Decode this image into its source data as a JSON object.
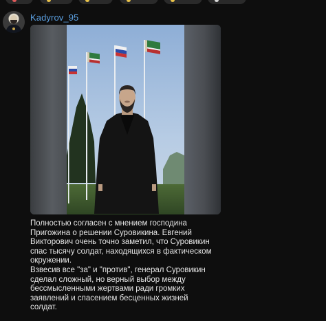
{
  "channel": {
    "name": "Kadyrov_95"
  },
  "post": {
    "image_description_icon": "photo-man-flags",
    "text_lines": [
      "Полностью согласен с мнением господина",
      "Пригожина о решении Суровикина. Евгений",
      "Викторович очень точно заметил, что Суровикин",
      "спас тысячу солдат, находящихся в фактическом",
      "окружении.",
      "Взвесив все \"за\" и \"против\", генерал Суровикин",
      "сделал сложный, но верный выбор между",
      "бессмысленными жертвами ради громких",
      "заявлений и спасением бесценных жизней",
      "солдат."
    ]
  },
  "colors": {
    "background": "#0e0e0e",
    "channel_name": "#5b9fe0",
    "text": "#e6e6e6"
  }
}
